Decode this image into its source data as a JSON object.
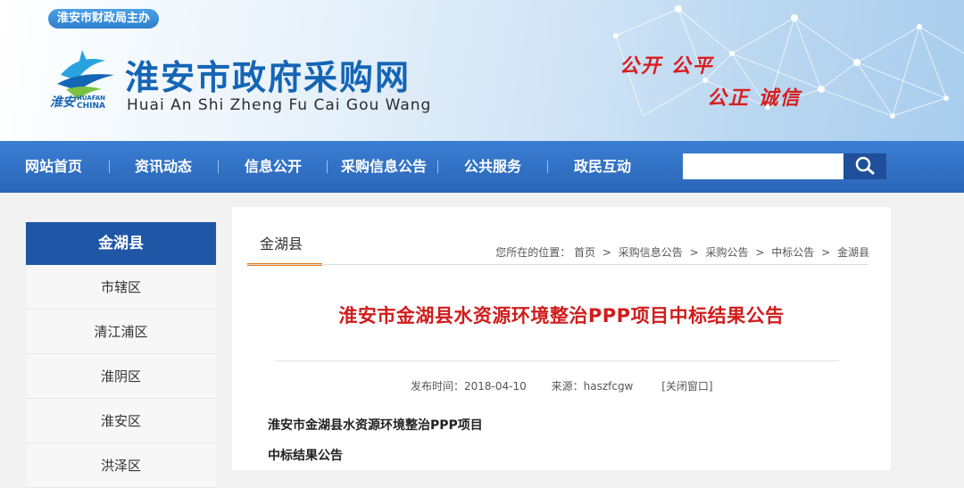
{
  "header": {
    "host_badge": "淮安市财政局主办",
    "title_cn": "淮安市政府采购网",
    "title_en": "Huai An Shi Zheng Fu Cai Gou Wang",
    "logo_script": "淮安",
    "logo_sub_1": "HUAFAN",
    "logo_sub_2": "CHINA",
    "slogan_line1": "公开 公平",
    "slogan_line2": "公正 诚信"
  },
  "nav": {
    "items": [
      {
        "label": "网站首页"
      },
      {
        "label": "资讯动态"
      },
      {
        "label": "信息公开"
      },
      {
        "label": "采购信息公告"
      },
      {
        "label": "公共服务"
      },
      {
        "label": "政民互动"
      }
    ],
    "search_placeholder": ""
  },
  "sidebar": {
    "heading": "金湖县",
    "items": [
      {
        "label": "市辖区"
      },
      {
        "label": "清江浦区"
      },
      {
        "label": "淮阴区"
      },
      {
        "label": "淮安区"
      },
      {
        "label": "洪泽区"
      }
    ]
  },
  "main": {
    "tab_title": "金湖县",
    "breadcrumb": {
      "prefix": "您所在的位置：",
      "items": [
        "首页",
        "采购信息公告",
        "采购公告",
        "中标公告",
        "金湖县"
      ],
      "separator": ">"
    },
    "article_title": "淮安市金湖县水资源环境整治PPP项目中标结果公告",
    "meta": {
      "published_label": "发布时间：",
      "published_date": "2018-04-10",
      "source_label": "来源：",
      "source_value": "haszfcgw",
      "close_label": "[关闭窗口]"
    },
    "body_lines": [
      "淮安市金湖县水资源环境整治PPP项目",
      "中标结果公告"
    ]
  },
  "colors": {
    "nav_blue": "#2f72c4",
    "sidebar_head": "#1f56a6",
    "title_red": "#d01c1c",
    "tab_accent": "#e67a1a"
  },
  "icons": {
    "search": "search-icon"
  }
}
